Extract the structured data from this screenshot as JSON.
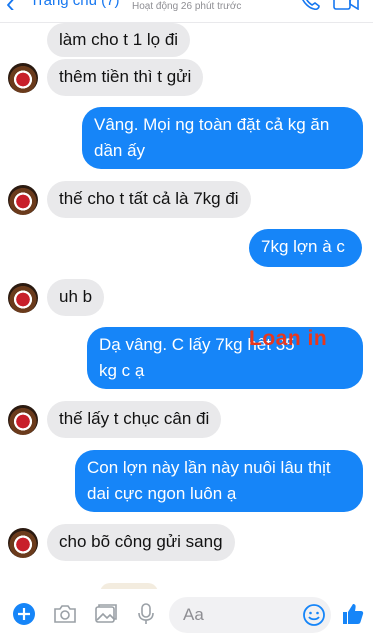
{
  "header": {
    "title": "Trang chủ (7)",
    "status": "Hoạt động 26 phút trước"
  },
  "messages": [
    {
      "side": "in",
      "text": "làm cho t 1 lọ đi",
      "avatar": false
    },
    {
      "side": "in",
      "text": "thêm tiền thì t gửi",
      "avatar": true
    },
    {
      "side": "out",
      "text": "Vâng. Mọi ng toàn đặt cả kg ăn\ndần ấy"
    },
    {
      "side": "in",
      "text": "thế cho t tất cả là 7kg đi",
      "avatar": true
    },
    {
      "side": "out",
      "text": "7kg lợn à c"
    },
    {
      "side": "in",
      "text": "uh b",
      "avatar": true
    },
    {
      "side": "out",
      "text": "Dạ vâng. C lấy 7kg hết 35  \nkg c ạ"
    },
    {
      "side": "in",
      "text": "thế lấy t chục cân đi",
      "avatar": true
    },
    {
      "side": "out",
      "text": "Con lợn này lần này nuôi lâu thịt\ndai cực ngon luôn ạ"
    },
    {
      "side": "in",
      "text": "cho bõ công gửi sang",
      "avatar": true
    }
  ],
  "watermark": "Loan in",
  "composer": {
    "placeholder": "Aa"
  },
  "icons": {
    "add": "plus-circle-icon",
    "camera": "camera-icon",
    "photo": "image-icon",
    "mic": "microphone-icon",
    "emoji": "smiley-icon",
    "like": "thumbs-up-icon"
  },
  "colors": {
    "accent": "#1685f8",
    "incoming_bubble": "#e9e9eb",
    "watermark": "#e8371d"
  }
}
